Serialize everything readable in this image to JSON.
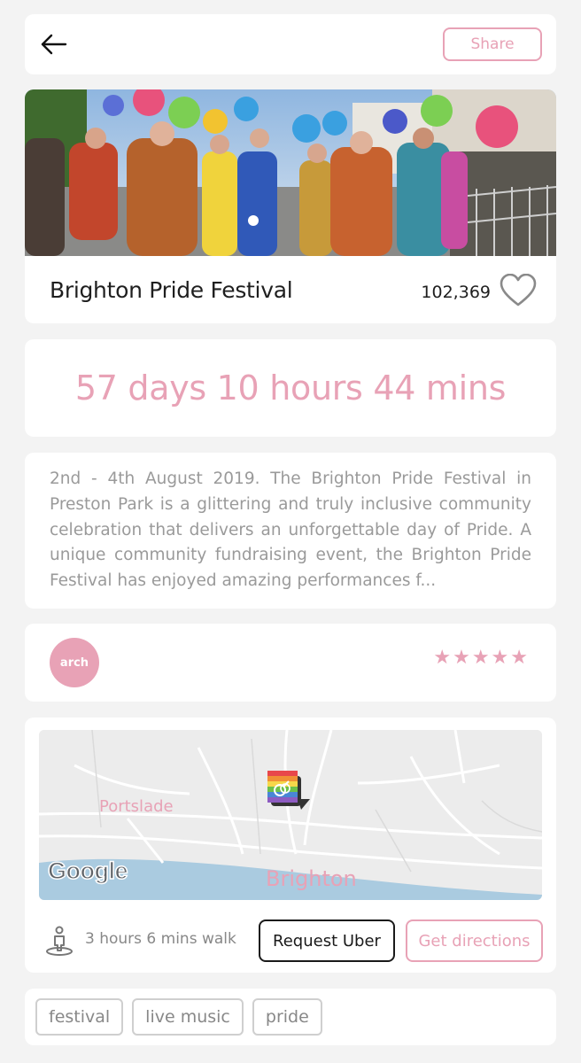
{
  "header": {
    "back_icon": "arrow-left-icon",
    "share_label": "Share"
  },
  "event": {
    "title": "Brighton Pride Festival",
    "like_count": "102,369",
    "like_icon": "heart-outline-icon"
  },
  "countdown": {
    "text": "57 days 10 hours 44 mins"
  },
  "description": {
    "text": "2nd - 4th August 2019. The Brighton Pride Festival in Preston Park is a glittering and truly inclusive community celebration that delivers an unforgettable day of Pride. A unique community fundraising event, the Brighton Pride Festival has enjoyed amazing performances f..."
  },
  "organizer": {
    "avatar_text": "arch",
    "rating_stars": "★★★★★",
    "rating_value": 5
  },
  "location": {
    "map": {
      "label_portslade": "Portslade",
      "label_brighton": "Brighton",
      "attribution": "Google"
    },
    "walk_icon": "walking-person-icon",
    "walk_text": "3 hours 6 mins walk",
    "uber_label": "Request Uber",
    "directions_label": "Get directions"
  },
  "tags": [
    "festival",
    "live music",
    "pride"
  ],
  "colors": {
    "accent": "#e8a2b6",
    "background": "#f3f3f3",
    "card": "#ffffff",
    "text_muted": "#9a9a9a"
  }
}
